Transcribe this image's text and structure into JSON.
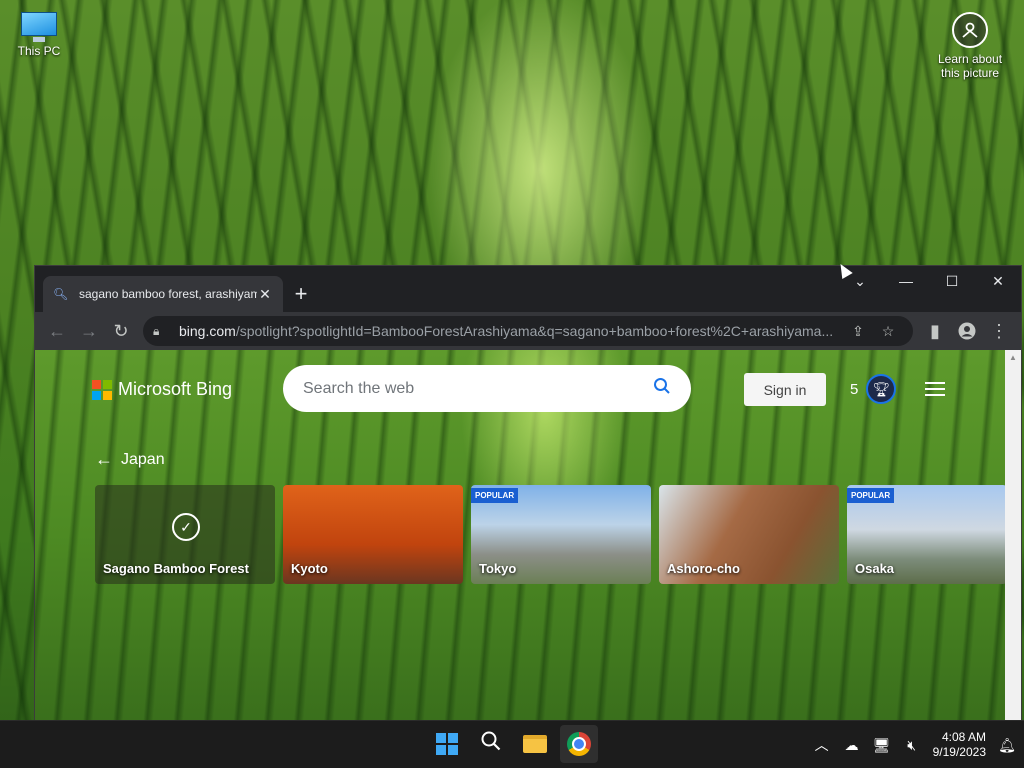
{
  "desktop": {
    "this_pc_label": "This PC",
    "learn_label": "Learn about this picture"
  },
  "browser": {
    "tab": {
      "title": "sagano bamboo forest, arashiyam",
      "close": "✕"
    },
    "new_tab": "+",
    "window_controls": {
      "tab_search": "⌄",
      "minimize": "—",
      "maximize": "☐",
      "close": "✕"
    },
    "omnibox": {
      "domain": "bing.com",
      "path": "/spotlight?spotlightId=BambooForestArashiyama&q=sagano+bamboo+forest%2C+arashiyama..."
    }
  },
  "bing": {
    "logo_text": "Microsoft Bing",
    "search_placeholder": "Search the web",
    "sign_in": "Sign in",
    "rewards_count": "5",
    "breadcrumb": "Japan",
    "cards": [
      {
        "name": "Sagano Bamboo Forest",
        "badge": "",
        "selected": true
      },
      {
        "name": "Kyoto",
        "badge": "",
        "selected": false
      },
      {
        "name": "Tokyo",
        "badge": "POPULAR",
        "selected": false
      },
      {
        "name": "Ashoro-cho",
        "badge": "",
        "selected": false
      },
      {
        "name": "Osaka",
        "badge": "POPULAR",
        "selected": false
      }
    ]
  },
  "taskbar": {
    "time": "4:08 AM",
    "date": "9/19/2023"
  },
  "colors": {
    "accent": "#1a73e8",
    "popular_badge": "#1a5fd1",
    "browser_frame": "#202124"
  }
}
